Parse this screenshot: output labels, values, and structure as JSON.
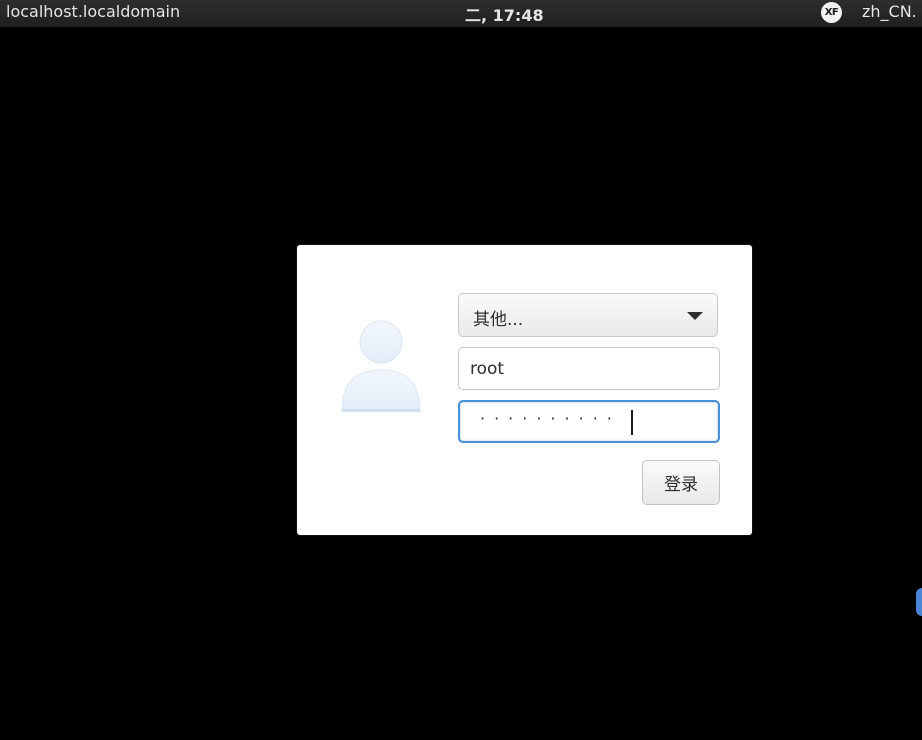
{
  "topbar": {
    "hostname": "localhost.localdomain",
    "clock": "二, 17:48",
    "input_method_icon": "xf-icon",
    "input_method_label": "XF",
    "language": "zh_CN."
  },
  "login_dialog": {
    "avatar_icon": "user-avatar-icon",
    "user_select": {
      "selected": "其他..."
    },
    "username": {
      "value": "root"
    },
    "password": {
      "masked_value": "··········"
    },
    "login_button_label": "登录"
  },
  "colors": {
    "background": "#000000",
    "focus_border": "#4a90d9",
    "avatar": "#e9f1fb"
  }
}
